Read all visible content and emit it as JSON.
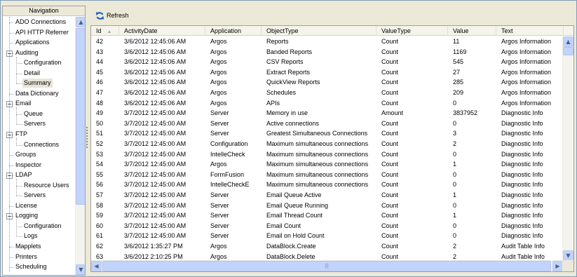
{
  "navigation": {
    "header": "Navigation",
    "items": [
      {
        "label": "ADO Connections",
        "level": 0,
        "toggle": null,
        "selected": false
      },
      {
        "label": "API HTTP Referrer",
        "level": 0,
        "toggle": null,
        "selected": false
      },
      {
        "label": "Applications",
        "level": 0,
        "toggle": null,
        "selected": false
      },
      {
        "label": "Auditing",
        "level": 0,
        "toggle": "−",
        "selected": false
      },
      {
        "label": "Configuration",
        "level": 1,
        "toggle": null,
        "selected": false
      },
      {
        "label": "Detail",
        "level": 1,
        "toggle": null,
        "selected": false
      },
      {
        "label": "Summary",
        "level": 1,
        "toggle": null,
        "selected": true
      },
      {
        "label": "Data Dictionary",
        "level": 0,
        "toggle": null,
        "selected": false
      },
      {
        "label": "Email",
        "level": 0,
        "toggle": "−",
        "selected": false
      },
      {
        "label": "Queue",
        "level": 1,
        "toggle": null,
        "selected": false
      },
      {
        "label": "Servers",
        "level": 1,
        "toggle": null,
        "selected": false
      },
      {
        "label": "FTP",
        "level": 0,
        "toggle": "−",
        "selected": false
      },
      {
        "label": "Connections",
        "level": 1,
        "toggle": null,
        "selected": false
      },
      {
        "label": "Groups",
        "level": 0,
        "toggle": null,
        "selected": false
      },
      {
        "label": "Inspector",
        "level": 0,
        "toggle": null,
        "selected": false
      },
      {
        "label": "LDAP",
        "level": 0,
        "toggle": "−",
        "selected": false
      },
      {
        "label": "Resource Users",
        "level": 1,
        "toggle": null,
        "selected": false
      },
      {
        "label": "Servers",
        "level": 1,
        "toggle": null,
        "selected": false
      },
      {
        "label": "License",
        "level": 0,
        "toggle": null,
        "selected": false
      },
      {
        "label": "Logging",
        "level": 0,
        "toggle": "−",
        "selected": false
      },
      {
        "label": "Configuration",
        "level": 1,
        "toggle": null,
        "selected": false
      },
      {
        "label": "Logs",
        "level": 1,
        "toggle": null,
        "selected": false
      },
      {
        "label": "Mapplets",
        "level": 0,
        "toggle": null,
        "selected": false
      },
      {
        "label": "Printers",
        "level": 0,
        "toggle": null,
        "selected": false
      },
      {
        "label": "Scheduling",
        "level": 0,
        "toggle": null,
        "selected": false
      }
    ]
  },
  "toolbar": {
    "refresh_label": "Refresh",
    "refresh_icon": "refresh-icon"
  },
  "table": {
    "sorted_column": "Id",
    "columns": [
      "Id",
      "ActivityDate",
      "Application",
      "ObjectType",
      "ValueType",
      "Value",
      "Text"
    ],
    "rows": [
      [
        "42",
        "3/6/2012 12:45:06 AM",
        "Argos",
        " Reports",
        "Count",
        "11",
        "Argos Information"
      ],
      [
        "43",
        "3/6/2012 12:45:06 AM",
        "Argos",
        "Banded Reports",
        "Count",
        "1169",
        "Argos Information"
      ],
      [
        "44",
        "3/6/2012 12:45:06 AM",
        "Argos",
        "CSV Reports",
        "Count",
        "545",
        "Argos Information"
      ],
      [
        "45",
        "3/6/2012 12:45:06 AM",
        "Argos",
        "Extract Reports",
        "Count",
        "27",
        "Argos Information"
      ],
      [
        "46",
        "3/6/2012 12:45:06 AM",
        "Argos",
        "QuickView Reports",
        "Count",
        "285",
        "Argos Information"
      ],
      [
        "47",
        "3/6/2012 12:45:06 AM",
        "Argos",
        "Schedules",
        "Count",
        "209",
        "Argos Information"
      ],
      [
        "48",
        "3/6/2012 12:45:06 AM",
        "Argos",
        "APIs",
        "Count",
        "0",
        "Argos Information"
      ],
      [
        "49",
        "3/7/2012 12:45:00 AM",
        "Server",
        "Memory in use",
        "Amount",
        "3837952",
        "Diagnostic Info"
      ],
      [
        "50",
        "3/7/2012 12:45:00 AM",
        "Server",
        "Active connections",
        "Count",
        "0",
        "Diagnostic Info"
      ],
      [
        "51",
        "3/7/2012 12:45:00 AM",
        "Server",
        "Greatest Simultaneous Connections",
        "Count",
        "3",
        "Diagnostic Info"
      ],
      [
        "52",
        "3/7/2012 12:45:00 AM",
        "Configuration",
        "Maximum simultaneous connections",
        "Count",
        "2",
        "Diagnostic Info"
      ],
      [
        "53",
        "3/7/2012 12:45:00 AM",
        "IntelleCheck",
        "Maximum simultaneous connections",
        "Count",
        "0",
        "Diagnostic Info"
      ],
      [
        "54",
        "3/7/2012 12:45:00 AM",
        "Argos",
        "Maximum simultaneous connections",
        "Count",
        "1",
        "Diagnostic Info"
      ],
      [
        "55",
        "3/7/2012 12:45:00 AM",
        "FormFusion",
        "Maximum simultaneous connections",
        "Count",
        "0",
        "Diagnostic Info"
      ],
      [
        "56",
        "3/7/2012 12:45:00 AM",
        "IntelleCheckE",
        "Maximum simultaneous connections",
        "Count",
        "0",
        "Diagnostic Info"
      ],
      [
        "57",
        "3/7/2012 12:45:00 AM",
        "Server",
        "Email Queue Active",
        "Count",
        "1",
        "Diagnostic Info"
      ],
      [
        "58",
        "3/7/2012 12:45:00 AM",
        "Server",
        "Email Queue Running",
        "Count",
        "0",
        "Diagnostic Info"
      ],
      [
        "59",
        "3/7/2012 12:45:00 AM",
        "Server",
        "Email Thread Count",
        "Count",
        "1",
        "Diagnostic Info"
      ],
      [
        "60",
        "3/7/2012 12:45:00 AM",
        "Server",
        "Email Count",
        "Count",
        "0",
        "Diagnostic Info"
      ],
      [
        "61",
        "3/7/2012 12:45:00 AM",
        "Server",
        "Email on Hold Count",
        "Count",
        "0",
        "Diagnostic Info"
      ],
      [
        "62",
        "3/6/2012 1:35:27 PM",
        "Argos",
        "DataBlock.Create",
        "Count",
        "2",
        "Audit Table Info"
      ],
      [
        "63",
        "3/6/2012 2:10:25 PM",
        "Argos",
        "DataBlock.Delete",
        "Count",
        "2",
        "Audit Table Info"
      ]
    ]
  },
  "scrollbars": {
    "up_glyph": "▲",
    "down_glyph": "▼",
    "left_glyph": "◀",
    "right_glyph": "▶",
    "grip_glyph": "|||"
  },
  "colors": {
    "window_bg": "#ece9d8",
    "refresh_blue": "#2060c0",
    "scroll_blue": "#c1d3fb"
  }
}
